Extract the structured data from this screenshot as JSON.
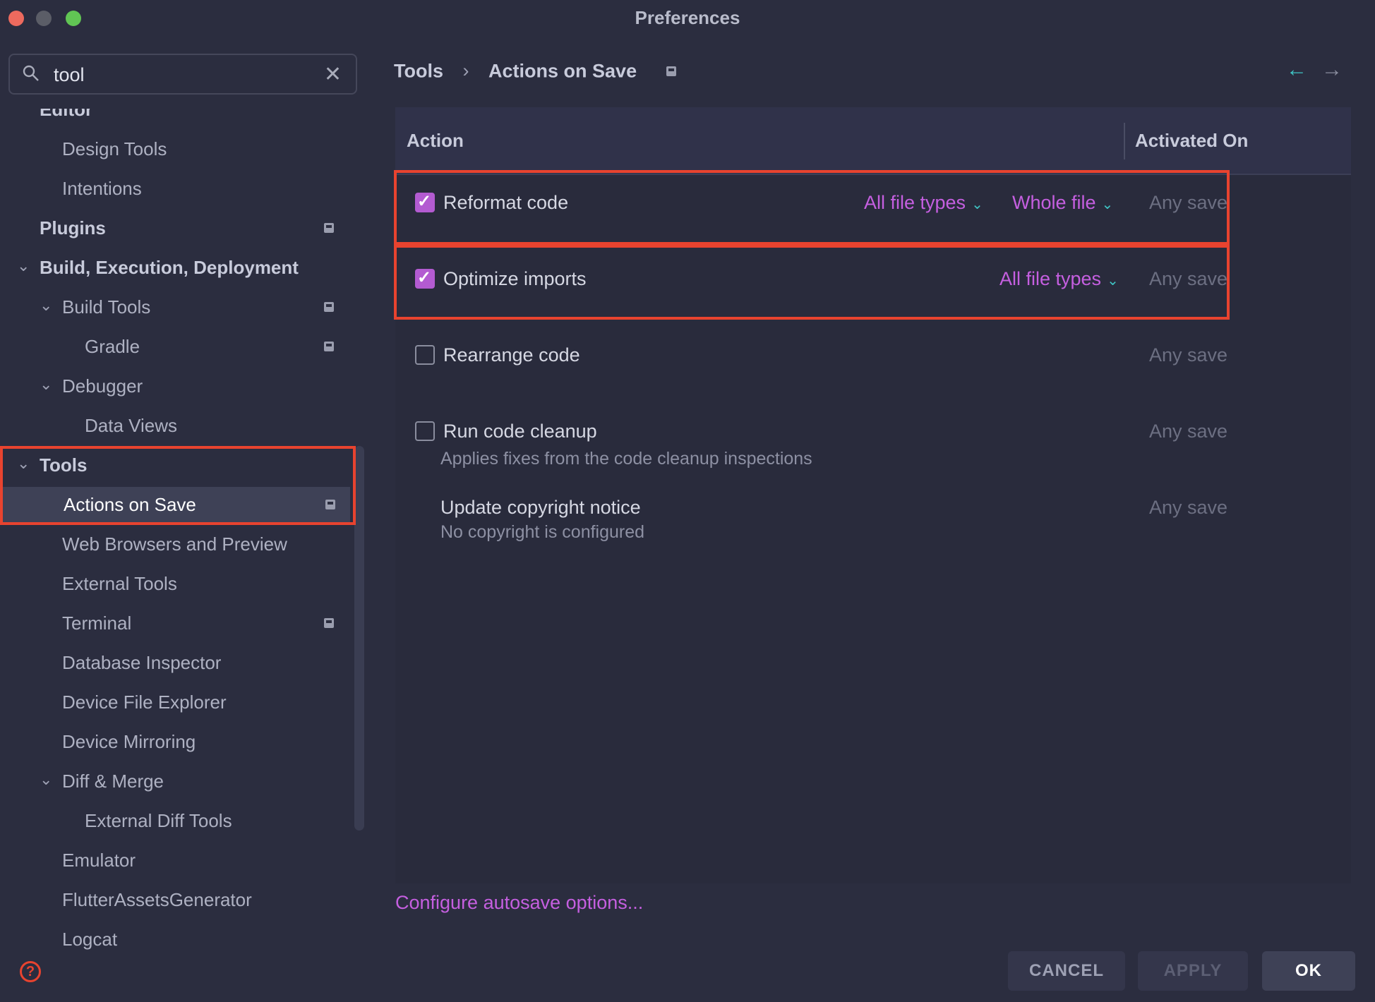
{
  "window": {
    "title": "Preferences"
  },
  "search": {
    "value": "tool",
    "placeholder": ""
  },
  "tree": [
    {
      "label": "Editor",
      "level": 0,
      "bold": true
    },
    {
      "label": "Design Tools",
      "level": 1
    },
    {
      "label": "Intentions",
      "level": 1
    },
    {
      "label": "Plugins",
      "level": 0,
      "bold": true,
      "badge": true
    },
    {
      "label": "Build, Execution, Deployment",
      "level": 0,
      "bold": true,
      "expanded": true
    },
    {
      "label": "Build Tools",
      "level": 1,
      "expanded": true,
      "badge": true
    },
    {
      "label": "Gradle",
      "level": 2,
      "badge": true
    },
    {
      "label": "Debugger",
      "level": 1,
      "expanded": true
    },
    {
      "label": "Data Views",
      "level": 2
    },
    {
      "label": "Tools",
      "level": 0,
      "bold": true,
      "expanded": true
    },
    {
      "label": "Actions on Save",
      "level": 1,
      "badge": true,
      "selected": true
    },
    {
      "label": "Web Browsers and Preview",
      "level": 1
    },
    {
      "label": "External Tools",
      "level": 1
    },
    {
      "label": "Terminal",
      "level": 1,
      "badge": true
    },
    {
      "label": "Database Inspector",
      "level": 1
    },
    {
      "label": "Device File Explorer",
      "level": 1
    },
    {
      "label": "Device Mirroring",
      "level": 1
    },
    {
      "label": "Diff & Merge",
      "level": 1,
      "expanded": true
    },
    {
      "label": "External Diff Tools",
      "level": 2
    },
    {
      "label": "Emulator",
      "level": 1
    },
    {
      "label": "FlutterAssetsGenerator",
      "level": 1
    },
    {
      "label": "Logcat",
      "level": 1
    }
  ],
  "breadcrumb": {
    "parent": "Tools",
    "current": "Actions on Save"
  },
  "table": {
    "col_action": "Action",
    "col_activated": "Activated On",
    "rows": [
      {
        "label": "Reformat code",
        "checked": true,
        "dropdowns": [
          "All file types",
          "Whole file"
        ],
        "activated": "Any save"
      },
      {
        "label": "Optimize imports",
        "checked": true,
        "dropdowns": [
          "All file types"
        ],
        "activated": "Any save"
      },
      {
        "label": "Rearrange code",
        "checked": false,
        "activated": "Any save"
      },
      {
        "label": "Run code cleanup",
        "checked": false,
        "sub": "Applies fixes from the code cleanup inspections",
        "activated": "Any save"
      },
      {
        "label": "Update copyright notice",
        "sub": "No copyright is configured",
        "activated": "Any save"
      }
    ]
  },
  "footer": {
    "autosave_link": "Configure autosave options...",
    "cancel": "CANCEL",
    "apply": "APPLY",
    "ok": "OK",
    "help_icon": "?"
  },
  "colors": {
    "background": "#2b2d3f",
    "accent": "#c55fe0",
    "checkbox": "#b35bd1",
    "highlight": "#e8432f",
    "teal": "#3fc4c4"
  }
}
